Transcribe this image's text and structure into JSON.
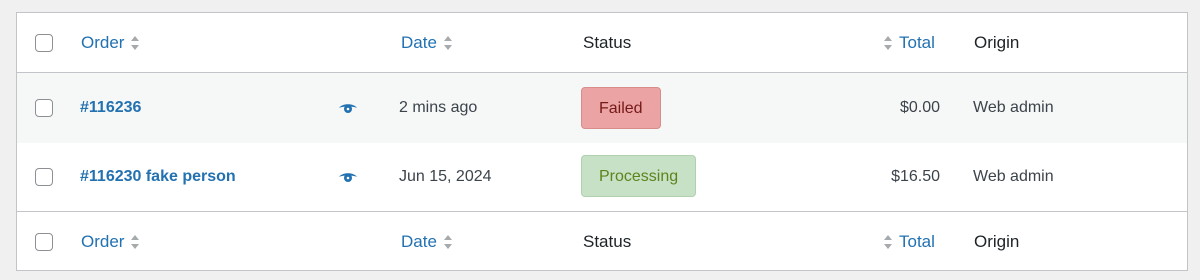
{
  "columns": {
    "order": "Order",
    "date": "Date",
    "status": "Status",
    "total": "Total",
    "origin": "Origin"
  },
  "orders": [
    {
      "id": "#116236",
      "date": "2 mins ago",
      "status": "Failed",
      "total": "$0.00",
      "origin": "Web admin"
    },
    {
      "id": "#116230 fake person",
      "date": "Jun 15, 2024",
      "status": "Processing",
      "total": "$16.50",
      "origin": "Web admin"
    }
  ],
  "colors": {
    "link": "#2271b1",
    "failed_bg": "#eba3a3",
    "failed_text": "#761919",
    "processing_bg": "#c6e1c6",
    "processing_text": "#5b841b"
  },
  "icons": {
    "sort": "sort-arrows-icon",
    "preview": "eye-icon"
  }
}
